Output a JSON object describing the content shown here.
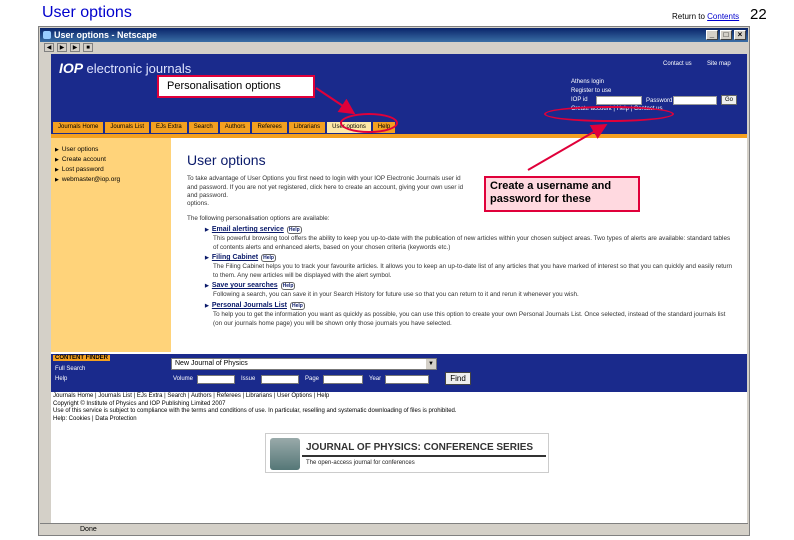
{
  "slide": {
    "title": "User options",
    "return_prefix": "Return to ",
    "return_link": "Contents",
    "number": "22"
  },
  "browser": {
    "window_title": "User options - Netscape",
    "status": "Done"
  },
  "site": {
    "logo_iop": "IOP",
    "logo_text": "electronic journals",
    "header_links": [
      "Contact us",
      "Site map"
    ],
    "login": {
      "heading": "Athens login",
      "register": "Register to use",
      "id_label": "IOP id",
      "password_label": "Password",
      "go_label": "Go",
      "links": "Create account | Help | Contact us"
    },
    "tabs": [
      "Journals Home",
      "Journals List",
      "EJs Extra",
      "Search",
      "Authors",
      "Referees",
      "Librarians",
      "User options",
      "Help"
    ],
    "active_tab": "User options"
  },
  "sidebar": {
    "items": [
      "User options",
      "Create account",
      "Lost password",
      "webmaster@iop.org"
    ]
  },
  "main": {
    "title": "User options",
    "intro": "To take advantage of User Options you first need to login with your IOP Electronic Journals user id and password. If you are not yet registered, click here to create an account, giving your own user id and password.",
    "intro_tail": "options.",
    "list_intro": "The following personalisation options are available:",
    "options": [
      {
        "label": "Email alerting service",
        "text": "This powerful browsing tool offers the ability to keep you up-to-date with the publication of new articles within your chosen subject areas. Two types of alerts are available: standard tables of contents alerts and enhanced alerts, based on your chosen criteria (keywords etc.)"
      },
      {
        "label": "Filing Cabinet",
        "text": "The Filing Cabinet helps you to track your favourite articles. It allows you to keep an up-to-date list of any articles that you have marked of interest so that you can quickly and easily return to them. Any new articles will be displayed with the alert symbol."
      },
      {
        "label": "Save your searches",
        "text": "Following a search, you can save it in your Search History for future use so that you can return to it and rerun it whenever you wish."
      },
      {
        "label": "Personal Journals List",
        "text": "To help you to get the information you want as quickly as possible, you can use this option to create your own Personal Journals List. Once selected, instead of the standard journals list (on our journals home page) you will be shown only those journals you have selected."
      }
    ],
    "help_badge": "Help"
  },
  "content_finder": {
    "label": "CONTENT FINDER",
    "links": [
      "Full Search",
      "Help"
    ],
    "select_value": "New Journal of Physics",
    "field_labels": [
      "Volume",
      "Issue",
      "Page",
      "Year"
    ],
    "find_label": "Find"
  },
  "footer": {
    "line1": "Journals Home | Journals List | EJs Extra | Search | Authors | Referees | Librarians | User Options | Help",
    "line2": "Copyright © Institute of Physics and IOP Publishing Limited 2007",
    "line3": "Use of this service is subject to compliance with the terms and conditions of use. In particular, reselling and systematic downloading of files is prohibited.",
    "line4": "Help: Cookies | Data Protection"
  },
  "banner": {
    "title": "JOURNAL OF PHYSICS: CONFERENCE SERIES",
    "subtitle": "The open-access journal for conferences"
  },
  "annotations": {
    "personalisation": "Personalisation options",
    "create_username": "Create a username and password for these"
  },
  "colors": {
    "accent_red": "#e0003a",
    "iop_blue": "#1a2a8c",
    "tab_orange": "#f4a020",
    "sidebar_yellow": "#ffd37a"
  }
}
